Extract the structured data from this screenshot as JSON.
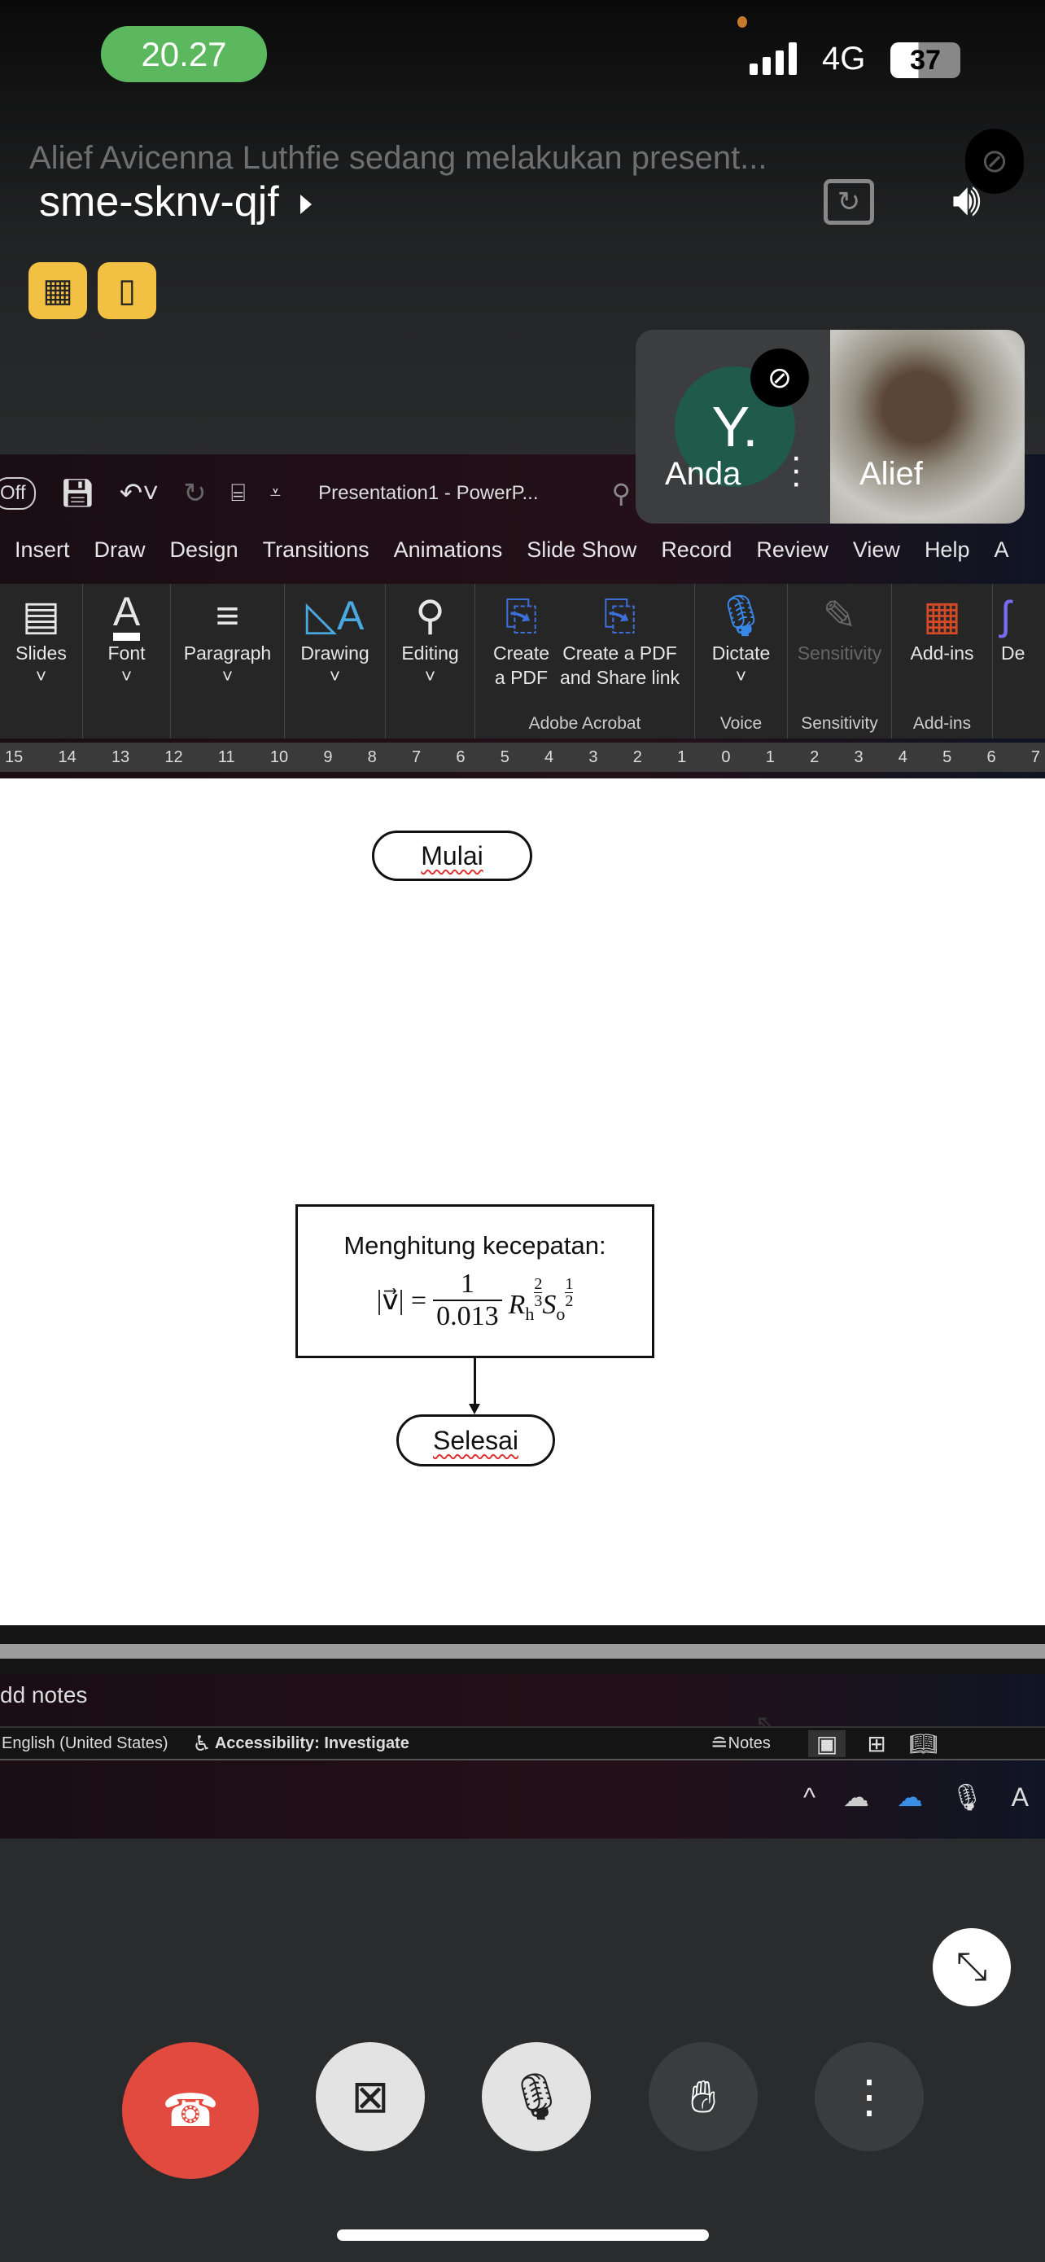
{
  "status_bar": {
    "time": "20.27",
    "network": "4G",
    "battery": "37"
  },
  "meet": {
    "presenting_text": "Alief Avicenna Luthfie sedang melakukan present...",
    "meeting_code": "sme-sknv-qjf",
    "self_tile": {
      "initial": "Y.",
      "name": "Anda"
    },
    "other_tile": {
      "name": "Alief"
    }
  },
  "ppt": {
    "autosave": "Off",
    "title": "Presentation1  -  PowerP...",
    "tabs": [
      "Insert",
      "Draw",
      "Design",
      "Transitions",
      "Animations",
      "Slide Show",
      "Record",
      "Review",
      "View",
      "Help",
      "A"
    ],
    "ribbon": [
      {
        "label": "Slides"
      },
      {
        "label": "Font"
      },
      {
        "label": "Paragraph"
      },
      {
        "label": "Drawing"
      },
      {
        "label": "Editing"
      },
      {
        "label": "Create a PDF"
      },
      {
        "label": "Create a PDF and Share link"
      },
      {
        "label": "Dictate"
      },
      {
        "label": "Sensitivity"
      },
      {
        "label": "Add-ins"
      },
      {
        "label": "De"
      }
    ],
    "groups": {
      "acrobat": "Adobe Acrobat",
      "voice": "Voice",
      "sensitivity": "Sensitivity",
      "addins": "Add-ins"
    },
    "ruler": [
      "15",
      "14",
      "13",
      "12",
      "11",
      "10",
      "9",
      "8",
      "7",
      "6",
      "5",
      "4",
      "3",
      "2",
      "1",
      "0",
      "1",
      "2",
      "3",
      "4",
      "5",
      "6",
      "7"
    ],
    "slide": {
      "start": "Mulai",
      "process": "Menghitung kecepatan:",
      "formula": "|v⃗| = 1/0.013 · Rₕ^(2/3) Sₒ^(1/2)",
      "frac_num": "1",
      "frac_den": "0.013",
      "lhs": "|v⃗| =",
      "exp1_num": "2",
      "exp1_den": "3",
      "exp2_num": "1",
      "exp2_den": "2",
      "end": "Selesai"
    },
    "notes_placeholder": "dd notes",
    "statusbar": {
      "language": "English (United States)",
      "accessibility": "Accessibility: Investigate",
      "notes": "Notes"
    },
    "taskbar_letter": "A"
  }
}
